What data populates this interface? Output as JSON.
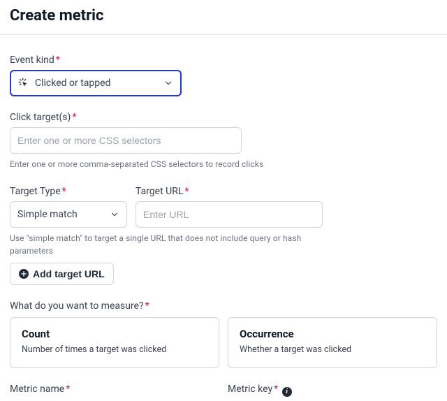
{
  "page": {
    "title": "Create metric"
  },
  "event_kind": {
    "label": "Event kind",
    "selected": "Clicked or tapped"
  },
  "click_targets": {
    "label": "Click target(s)",
    "placeholder": "Enter one or more CSS selectors",
    "help": "Enter one or more comma-separated CSS selectors to record clicks"
  },
  "target_type": {
    "label": "Target Type",
    "selected": "Simple match"
  },
  "target_url": {
    "label": "Target URL",
    "placeholder": "Enter URL"
  },
  "target_help": "Use \"simple match\" to target a single URL that does not include query or hash parameters",
  "add_target_btn": "Add target URL",
  "measure": {
    "label": "What do you want to measure?",
    "options": [
      {
        "title": "Count",
        "desc": "Number of times a target was clicked"
      },
      {
        "title": "Occurrence",
        "desc": "Whether a target was clicked"
      }
    ]
  },
  "metric_name": {
    "label": "Metric name"
  },
  "metric_key": {
    "label": "Metric key"
  }
}
